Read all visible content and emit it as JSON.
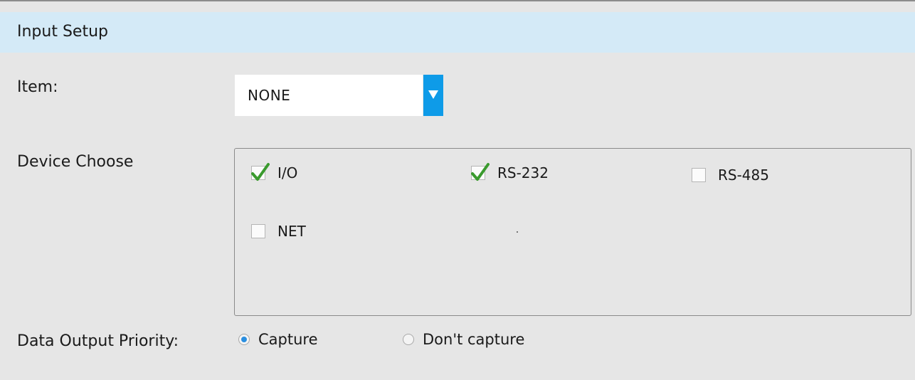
{
  "header": {
    "title": "Input Setup"
  },
  "item": {
    "label": "Item:",
    "selected": "NONE"
  },
  "device": {
    "label": "Device Choose",
    "options": [
      {
        "label": "I/O",
        "checked": true
      },
      {
        "label": "RS-232",
        "checked": true
      },
      {
        "label": "RS-485",
        "checked": false
      },
      {
        "label": "NET",
        "checked": false
      }
    ]
  },
  "priority": {
    "label": "Data Output Priority:",
    "options": [
      {
        "label": "Capture",
        "selected": true
      },
      {
        "label": "Don't capture",
        "selected": false
      }
    ]
  },
  "colors": {
    "header_bg": "#d4eaf7",
    "dropdown_accent": "#0e9be8",
    "check_green": "#3a9a2e",
    "radio_blue": "#2b8fe0"
  }
}
